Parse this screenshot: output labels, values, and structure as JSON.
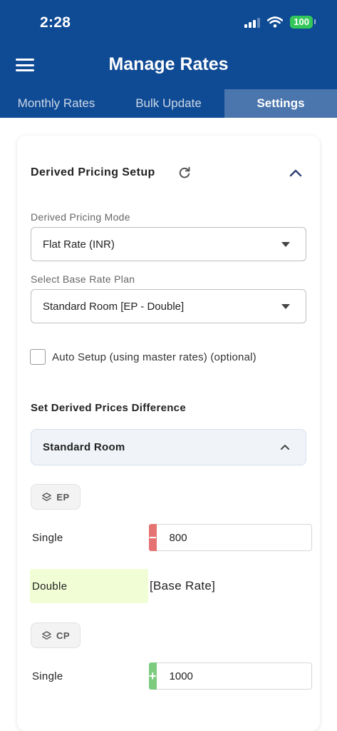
{
  "status_bar": {
    "time": "2:28",
    "battery": "100"
  },
  "header": {
    "title": "Manage Rates"
  },
  "tabs": [
    {
      "label": "Monthly Rates"
    },
    {
      "label": "Bulk Update"
    },
    {
      "label": "Settings"
    }
  ],
  "settings": {
    "section_title": "Derived Pricing Setup",
    "pricing_mode": {
      "label": "Derived Pricing Mode",
      "value": "Flat Rate (INR)"
    },
    "base_rate_plan": {
      "label": "Select Base Rate Plan",
      "value": "Standard Room [EP - Double]"
    },
    "auto_setup": {
      "label": "Auto Setup (using master rates) (optional)",
      "checked": false
    },
    "difference_title": "Set Derived Prices Difference",
    "room": {
      "name": "Standard Room",
      "plans": [
        {
          "code": "EP",
          "rows": [
            {
              "occupancy": "Single",
              "sign": "−",
              "value": "800"
            },
            {
              "occupancy": "Double",
              "note": "[Base Rate]"
            }
          ]
        },
        {
          "code": "CP",
          "rows": [
            {
              "occupancy": "Single",
              "sign": "+",
              "value": "1000"
            }
          ]
        }
      ]
    }
  },
  "colors": {
    "header_bg": "#0f4a94",
    "active_tab_bg": "#4a76ad",
    "minus": "#e57373",
    "plus": "#7ccb7f",
    "base_highlight": "#f1fdd4"
  }
}
